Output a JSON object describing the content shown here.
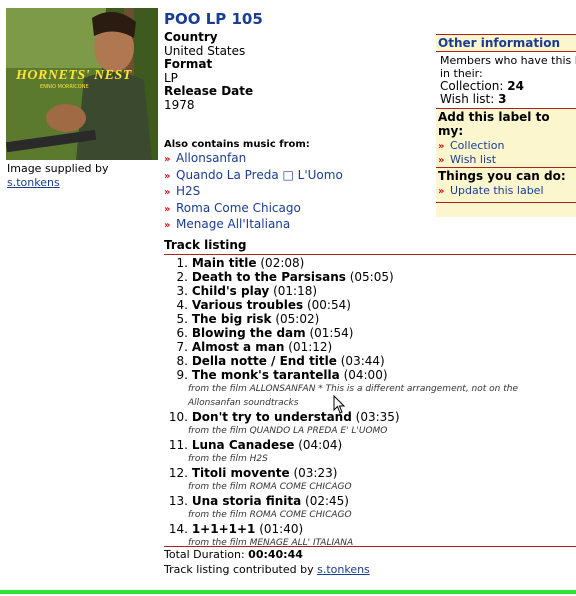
{
  "cover": {
    "line1": "HORNETS' NEST",
    "line2": "ENNIO MORRICONE"
  },
  "caption": {
    "supplied_by": "Image supplied by",
    "user": "s.tonkens"
  },
  "release": {
    "title": "POO LP 105",
    "country_label": "Country",
    "country": "United States",
    "format_label": "Format",
    "format": "LP",
    "date_label": "Release Date",
    "date": "1978"
  },
  "also": {
    "label": "Also contains music from:",
    "items": [
      "Allonsanfan",
      "Quando La Preda □ L'Uomo",
      "H2S",
      "Roma Come Chicago",
      "Menage All'Italiana"
    ]
  },
  "sidebar": {
    "other_title": "Other information",
    "members_text1": "Members who have this l",
    "members_text2": "in their:",
    "collection_label": "Collection:",
    "collection_count": "24",
    "wishlist_label": "Wish list:",
    "wishlist_count": "3",
    "add_title": "Add this label to my:",
    "add_collection": "Collection",
    "add_wishlist": "Wish list",
    "things_title": "Things you can do:",
    "update": "Update this label"
  },
  "tracks_title": "Track listing",
  "tracks": [
    {
      "n": "1.",
      "title": "Main title",
      "dur": "(02:08)"
    },
    {
      "n": "2.",
      "title": "Death to the Parsisans",
      "dur": "(05:05)"
    },
    {
      "n": "3.",
      "title": "Child's play",
      "dur": "(01:18)"
    },
    {
      "n": "4.",
      "title": "Various troubles",
      "dur": "(00:54)"
    },
    {
      "n": "5.",
      "title": "The big risk",
      "dur": "(05:02)"
    },
    {
      "n": "6.",
      "title": "Blowing the dam",
      "dur": "(01:54)"
    },
    {
      "n": "7.",
      "title": "Almost a man",
      "dur": "(01:12)"
    },
    {
      "n": "8.",
      "title": "Della notte / End title",
      "dur": "(03:44)"
    },
    {
      "n": "9.",
      "title": "The monk's tarantella",
      "dur": "(04:00)",
      "note1": "from the film ALLONSANFAN * This is a different arrangement, not on the",
      "note2": "Allonsanfan soundtracks"
    },
    {
      "n": "10.",
      "title": "Don't try to understand",
      "dur": "(03:35)",
      "note1": "from the film QUANDO LA PREDA E' L'UOMO"
    },
    {
      "n": "11.",
      "title": "Luna Canadese",
      "dur": "(04:04)",
      "note1": "from the film H2S"
    },
    {
      "n": "12.",
      "title": "Titoli movente",
      "dur": "(03:23)",
      "note1": "from the film ROMA COME CHICAGO"
    },
    {
      "n": "13.",
      "title": "Una storia finita",
      "dur": "(02:45)",
      "note1": "from the film ROMA COME CHICAGO"
    },
    {
      "n": "14.",
      "title": "1+1+1+1",
      "dur": "(01:40)",
      "note1": "from the film MENAGE ALL' ITALIANA"
    }
  ],
  "total_label": "Total Duration:",
  "total": "00:40:44",
  "contrib_label": "Track listing contributed by",
  "contrib_user": "s.tonkens"
}
